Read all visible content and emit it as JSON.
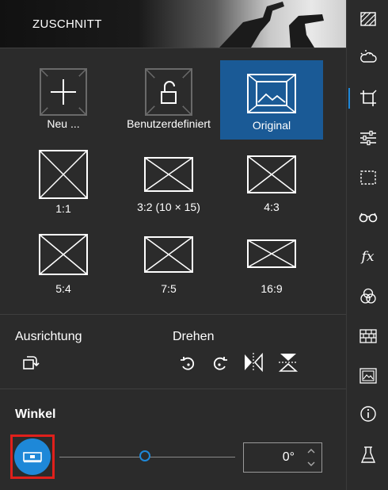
{
  "header": {
    "title": "ZUSCHNITT"
  },
  "crop_presets": [
    {
      "label": "Neu ...",
      "selected": false,
      "icon": "plus-icon"
    },
    {
      "label": "Benutzerdefiniert",
      "selected": false,
      "icon": "unlock-icon"
    },
    {
      "label": "Original",
      "selected": true,
      "icon": "image-icon"
    },
    {
      "label": "1:1",
      "selected": false,
      "icon": "ratio-icon"
    },
    {
      "label": "3:2 (10 × 15)",
      "selected": false,
      "icon": "ratio-icon"
    },
    {
      "label": "4:3",
      "selected": false,
      "icon": "ratio-icon"
    },
    {
      "label": "5:4",
      "selected": false,
      "icon": "ratio-icon"
    },
    {
      "label": "7:5",
      "selected": false,
      "icon": "ratio-icon"
    },
    {
      "label": "16:9",
      "selected": false,
      "icon": "ratio-icon"
    }
  ],
  "orientation": {
    "label": "Ausrichtung"
  },
  "rotate": {
    "label": "Drehen"
  },
  "angle": {
    "label": "Winkel",
    "value": "0°",
    "slider_fraction": 0.5
  },
  "colors": {
    "accent": "#1a5a96",
    "level_button": "#1e88d8",
    "highlight_border": "#e0201b",
    "background": "#2b2b2b"
  },
  "sidebar": {
    "active": "crop-icon",
    "icons": [
      "scene-icon",
      "weather-icon",
      "crop-icon",
      "adjust-sliders-icon",
      "selection-icon",
      "glasses-icon",
      "fx-icon",
      "color-circles-icon",
      "texture-icon",
      "frame-icon",
      "info-icon",
      "flask-icon"
    ],
    "fx_text": "fx"
  }
}
